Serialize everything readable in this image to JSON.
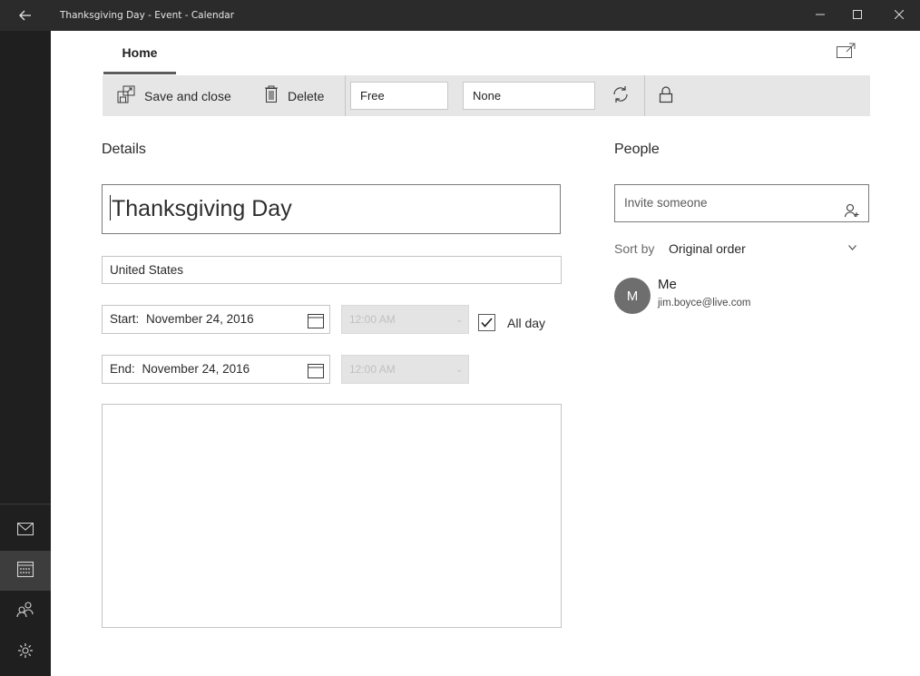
{
  "window": {
    "title": "Thanksgiving Day - Event - Calendar",
    "back_icon": "arrow-left-icon",
    "minimize_icon": "minimize-icon",
    "maximize_icon": "maximize-icon",
    "close_icon": "close-icon"
  },
  "rail": {
    "items": [
      {
        "icon": "mail-icon",
        "active": false
      },
      {
        "icon": "calendar-icon",
        "active": true
      },
      {
        "icon": "people-icon",
        "active": false
      },
      {
        "icon": "settings-icon",
        "active": false
      }
    ]
  },
  "tabs": {
    "home_label": "Home",
    "popout_icon": "popout-window-icon"
  },
  "toolbar": {
    "save_label": "Save and close",
    "delete_label": "Delete",
    "show_as_value": "Free",
    "reminder_value": "None",
    "repeat_icon": "repeat-icon",
    "private_icon": "lock-icon"
  },
  "details": {
    "heading": "Details",
    "event_title": "Thanksgiving Day",
    "location": "United States",
    "start": {
      "label": "Start:",
      "date": "November 24, 2016",
      "time": "12:00 AM"
    },
    "end": {
      "label": "End:",
      "date": "November 24, 2016",
      "time": "12:00 AM"
    },
    "all_day_label": "All day",
    "all_day_checked": true,
    "notes": ""
  },
  "people": {
    "heading": "People",
    "invite_placeholder": "Invite someone",
    "sort_label": "Sort by",
    "sort_value": "Original order",
    "attendees": [
      {
        "initial": "M",
        "name": "Me",
        "email": "jim.boyce@live.com"
      }
    ]
  },
  "colors": {
    "titlebar": "#2b2b2b",
    "rail": "#1f1f1f",
    "toolbar": "#e6e6e6",
    "avatar": "#6e6e6e"
  }
}
